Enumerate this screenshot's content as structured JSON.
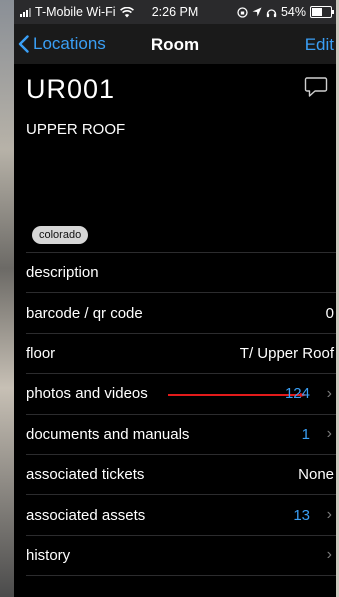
{
  "status_bar": {
    "carrier": "T-Mobile Wi-Fi",
    "time": "2:26 PM",
    "battery": "54%"
  },
  "nav": {
    "back_label": "Locations",
    "title": "Room",
    "edit_label": "Edit"
  },
  "room": {
    "id": "UR001",
    "name": "UPPER ROOF",
    "tag": "colorado"
  },
  "rows": [
    {
      "label": "description",
      "value": "",
      "chevron": false
    },
    {
      "label": "barcode / qr code",
      "value": "0",
      "chevron": false
    },
    {
      "label": "floor",
      "value": "T/ Upper Roof",
      "chevron": false
    },
    {
      "label": "photos and videos",
      "value": "124",
      "chevron": true
    },
    {
      "label": "documents and manuals",
      "value": "1",
      "chevron": true
    },
    {
      "label": "associated tickets",
      "value": "None",
      "chevron": false
    },
    {
      "label": "associated assets",
      "value": "13",
      "chevron": true
    },
    {
      "label": "history",
      "value": "",
      "chevron": true
    }
  ],
  "colors": {
    "accent": "#3a9ff5",
    "annotation_arrow": "#e31b1b"
  }
}
